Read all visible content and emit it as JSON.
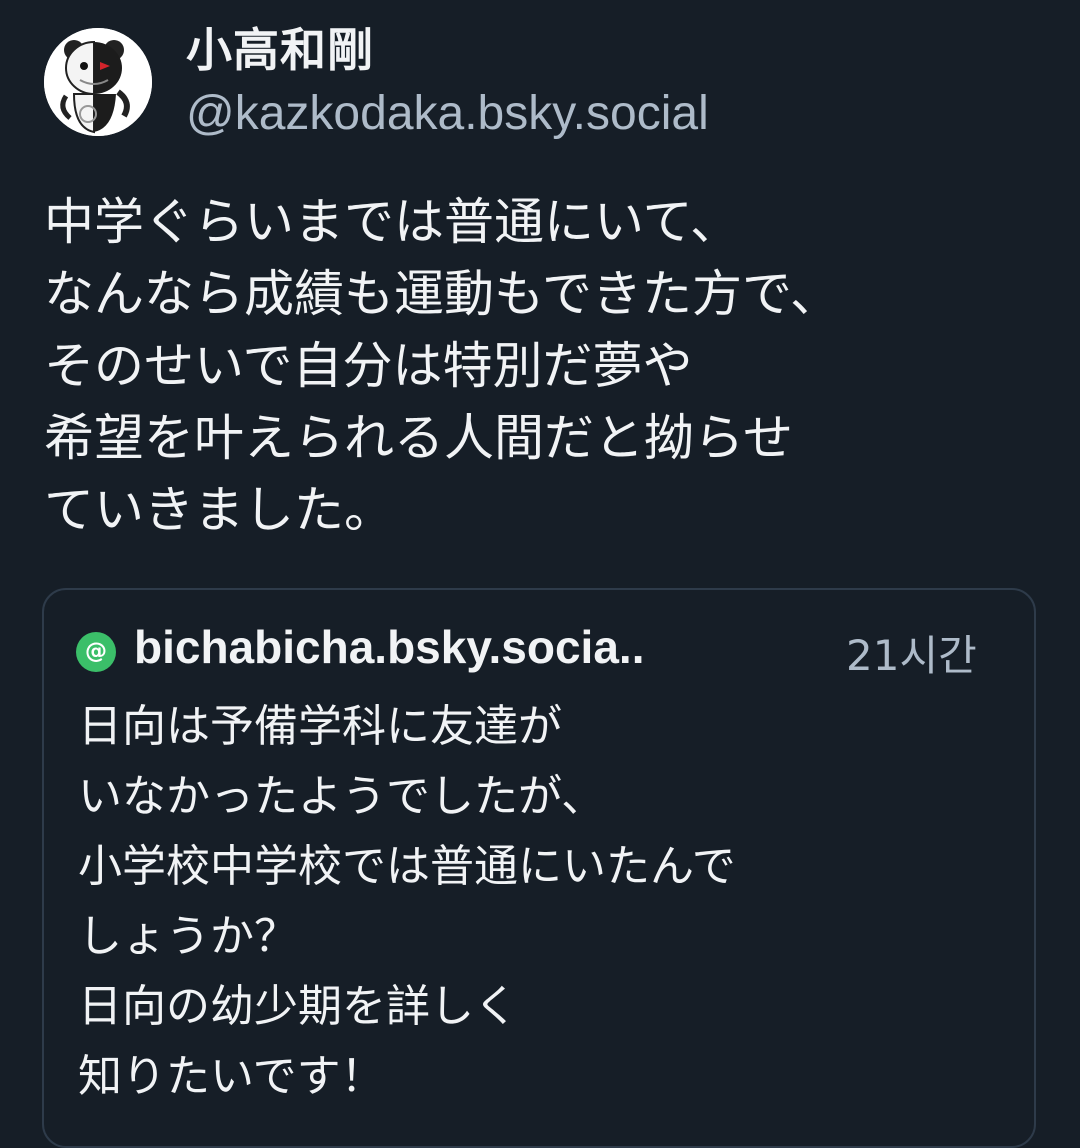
{
  "author": {
    "name": "小高和剛",
    "handle": "@kazkodaka.bsky.social",
    "avatar_icon": "monokuma-avatar-icon"
  },
  "post": {
    "lines": [
      "中学ぐらいまでは普通にいて、",
      "なんなら成績も運動もできた方で、",
      "そのせいで自分は特別だ夢や",
      "希望を叶えられる人間だと拗らせ",
      "ていきました。"
    ]
  },
  "quote": {
    "avatar_glyph": "@",
    "handle": "bichabicha.bsky.socia..",
    "time": "21시간",
    "lines": [
      "日向は予備学科に友達が",
      "いなかったようでしたが、",
      "小学校中学校では普通にいたんで",
      "しょうか？",
      "日向の幼少期を詳しく",
      "知りたいです！"
    ]
  },
  "colors": {
    "background": "#161e27",
    "text": "#f1f3f5",
    "secondary_text": "#aebbc9",
    "card_border": "#2e3b4a",
    "quote_avatar": "#3bbf69"
  }
}
